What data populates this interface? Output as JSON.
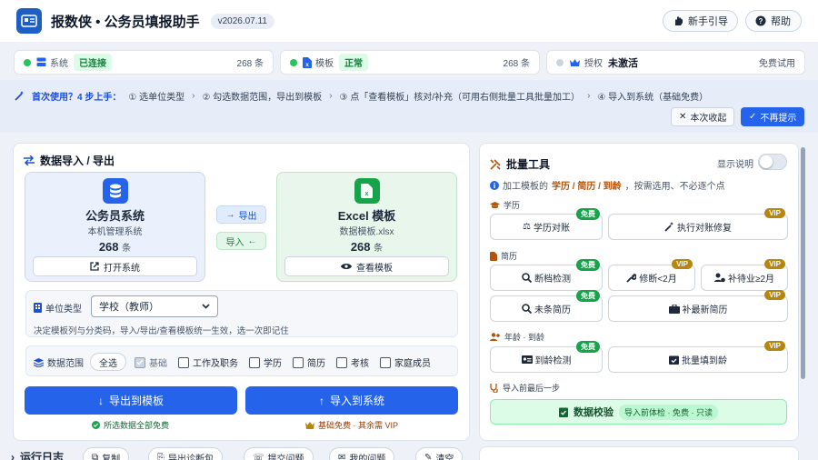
{
  "header": {
    "title": "报数侠 • 公务员填报助手",
    "version": "v2026.07.11",
    "guide_label": "新手引导",
    "help_label": "帮助"
  },
  "status": {
    "system": {
      "label": "系统",
      "state": "已连接",
      "count": "268 条"
    },
    "template": {
      "label": "模板",
      "state": "正常",
      "count": "268 条"
    },
    "license": {
      "label": "授权",
      "state": "未激活",
      "note": "免费试用"
    }
  },
  "onboarding": {
    "title": "首次使用？4 步上手：",
    "steps": [
      "① 选单位类型",
      "② 勾选数据范围，导出到模板",
      "③ 点「查看模板」核对/补充（可用右侧批量工具批量加工）",
      "④ 导入到系统（基础免费）"
    ],
    "collapse_label": "本次收起",
    "dismiss_label": "不再提示"
  },
  "import_export": {
    "title": "数据导入 / 导出",
    "system_card": {
      "title": "公务员系统",
      "subtitle": "本机管理系统",
      "count": "268",
      "unit": "条",
      "button": "打开系统"
    },
    "excel_card": {
      "title": "Excel 模板",
      "subtitle": "数据模板.xlsx",
      "count": "268",
      "unit": "条",
      "button": "查看模板"
    },
    "export_small": "导出",
    "import_small": "导入",
    "unit_type": {
      "label": "单位类型",
      "selected": "学校（教师）",
      "hint": "决定模板列与分类码，导入/导出/查看模板统一生效，选一次即记住"
    },
    "data_range": {
      "label": "数据范围",
      "select_all": "全选",
      "options": [
        {
          "label": "基础",
          "checked": true,
          "disabled": true
        },
        {
          "label": "工作及职务",
          "checked": false
        },
        {
          "label": "学历",
          "checked": false
        },
        {
          "label": "简历",
          "checked": false
        },
        {
          "label": "考核",
          "checked": false
        },
        {
          "label": "家庭成员",
          "checked": false
        }
      ]
    },
    "export_button": "导出到模板",
    "import_button": "导入到系统",
    "export_note": "所选数据全部免费",
    "import_note": "基础免费 · 其余需 VIP"
  },
  "batch_tools": {
    "title": "批量工具",
    "toggle_label": "显示说明",
    "tip_prefix": "加工模板的",
    "tip_highlight": "学历 / 简历 / 到龄",
    "tip_suffix": "，按需选用、不必逐个点",
    "sections": {
      "education": "学历",
      "resume": "简历",
      "age": "年龄 · 到龄",
      "final": "导入前最后一步"
    },
    "tools": {
      "edu_check": {
        "label": "学历对账",
        "badge": "免费"
      },
      "edu_fix": {
        "label": "执行对账修复",
        "badge": "VIP"
      },
      "resume_gap": {
        "label": "断档检测",
        "badge": "免费"
      },
      "resume_fix": {
        "label": "修断<2月",
        "badge": "VIP"
      },
      "resume_wait": {
        "label": "补待业≥2月",
        "badge": "VIP"
      },
      "resume_end": {
        "label": "未条简历",
        "badge": "免费"
      },
      "resume_latest": {
        "label": "补最新简历",
        "badge": "VIP"
      },
      "age_check": {
        "label": "到龄检测",
        "badge": "免费"
      },
      "age_fill": {
        "label": "批量填到龄",
        "badge": "VIP"
      }
    },
    "verify_label": "数据校验",
    "verify_pill": "导入前体检 · 免费 · 只读"
  },
  "log": {
    "title": "运行日志",
    "buttons": [
      "复制",
      "导出诊断包",
      "提交问题",
      "我的问题",
      "清空"
    ]
  },
  "colors": {
    "accent": "#2563eb",
    "success": "#16a34a",
    "vip": "#b8860b"
  }
}
